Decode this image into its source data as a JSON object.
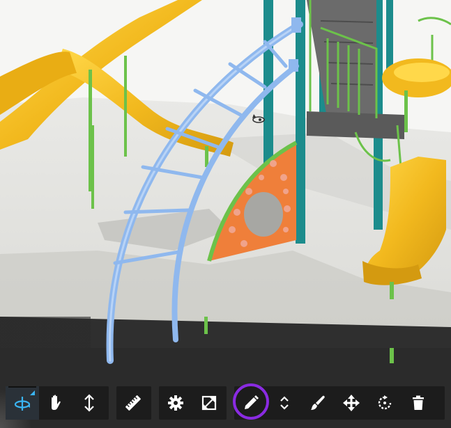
{
  "app": {
    "accent_color": "#3ab4f2",
    "highlight_color": "#8a2be2",
    "active_tool": "orbit"
  },
  "viewport": {
    "description_icon": "orbit-cursor-icon"
  },
  "toolbar": {
    "groups": [
      {
        "name": "navigation",
        "tools": [
          {
            "id": "orbit",
            "icon": "orbit-icon",
            "active": true
          },
          {
            "id": "pan",
            "icon": "hand-icon",
            "active": false
          },
          {
            "id": "zoom",
            "icon": "vertical-arrows-icon",
            "active": false
          }
        ]
      },
      {
        "name": "measure",
        "tools": [
          {
            "id": "measure",
            "icon": "ruler-icon",
            "active": false
          }
        ]
      },
      {
        "name": "settings",
        "tools": [
          {
            "id": "settings",
            "icon": "gear-icon",
            "active": false
          },
          {
            "id": "expand",
            "icon": "expand-icon",
            "active": false
          }
        ]
      },
      {
        "name": "edit",
        "tools": [
          {
            "id": "edit",
            "icon": "pencil-icon",
            "active": false,
            "highlighted": true
          },
          {
            "id": "adjust-height",
            "icon": "up-down-chevron-icon",
            "active": false
          },
          {
            "id": "paint",
            "icon": "paintbrush-icon",
            "active": false
          },
          {
            "id": "move",
            "icon": "move-arrows-icon",
            "active": false
          },
          {
            "id": "rotate",
            "icon": "rotate-icon",
            "active": false
          },
          {
            "id": "delete",
            "icon": "trash-icon",
            "active": false
          }
        ]
      }
    ]
  }
}
